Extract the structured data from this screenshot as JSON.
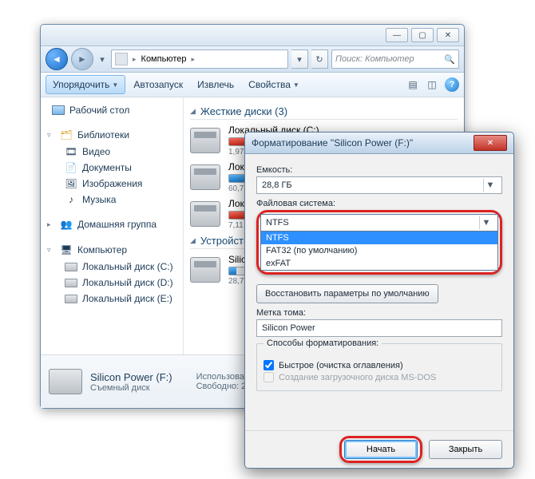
{
  "explorer": {
    "breadcrumb_root": "Компьютер",
    "search_placeholder": "Поиск: Компьютер",
    "toolbar": {
      "organize": "Упорядочить",
      "autoplay": "Автозапуск",
      "eject": "Извлечь",
      "properties": "Свойства"
    },
    "sidebar": {
      "favorites": {
        "desktop": "Рабочий стол"
      },
      "libraries": {
        "label": "Библиотеки",
        "items": [
          "Видео",
          "Документы",
          "Изображения",
          "Музыка"
        ]
      },
      "homegroup": "Домашняя группа",
      "computer": {
        "label": "Компьютер",
        "drives": [
          "Локальный диск (C:)",
          "Локальный диск (D:)",
          "Локальный диск (E:)"
        ]
      }
    },
    "content": {
      "hdd_header": "Жесткие диски (3)",
      "drive_c": {
        "name": "Локальный диск (C:)",
        "size": "1,97 ТБ"
      },
      "drive_d_prefix": "Лок",
      "drive_d_size": "60,7",
      "drive_e_prefix": "Лок",
      "drive_e_size": "7,11",
      "devices_header": "Устройства",
      "removable": {
        "name_prefix": "Silic",
        "size": "28,7"
      }
    },
    "details": {
      "name": "Silicon Power (F:)",
      "type": "Съемный диск",
      "used_label": "Использовано:",
      "free_label": "Свободно:",
      "free_value": "28,7"
    }
  },
  "format_dialog": {
    "title": "Форматирование \"Silicon Power (F:)\"",
    "capacity_label": "Емкость:",
    "capacity_value": "28,8 ГБ",
    "fs_label": "Файловая система:",
    "fs_selected": "NTFS",
    "fs_options": [
      "NTFS",
      "FAT32 (по умолчанию)",
      "exFAT"
    ],
    "restore_defaults": "Восстановить параметры по умолчанию",
    "volume_label": "Метка тома:",
    "volume_value": "Silicon Power",
    "methods_label": "Способы форматирования:",
    "quick": "Быстрое (очистка оглавления)",
    "msdos": "Создание загрузочного диска MS-DOS",
    "start": "Начать",
    "close": "Закрыть"
  }
}
